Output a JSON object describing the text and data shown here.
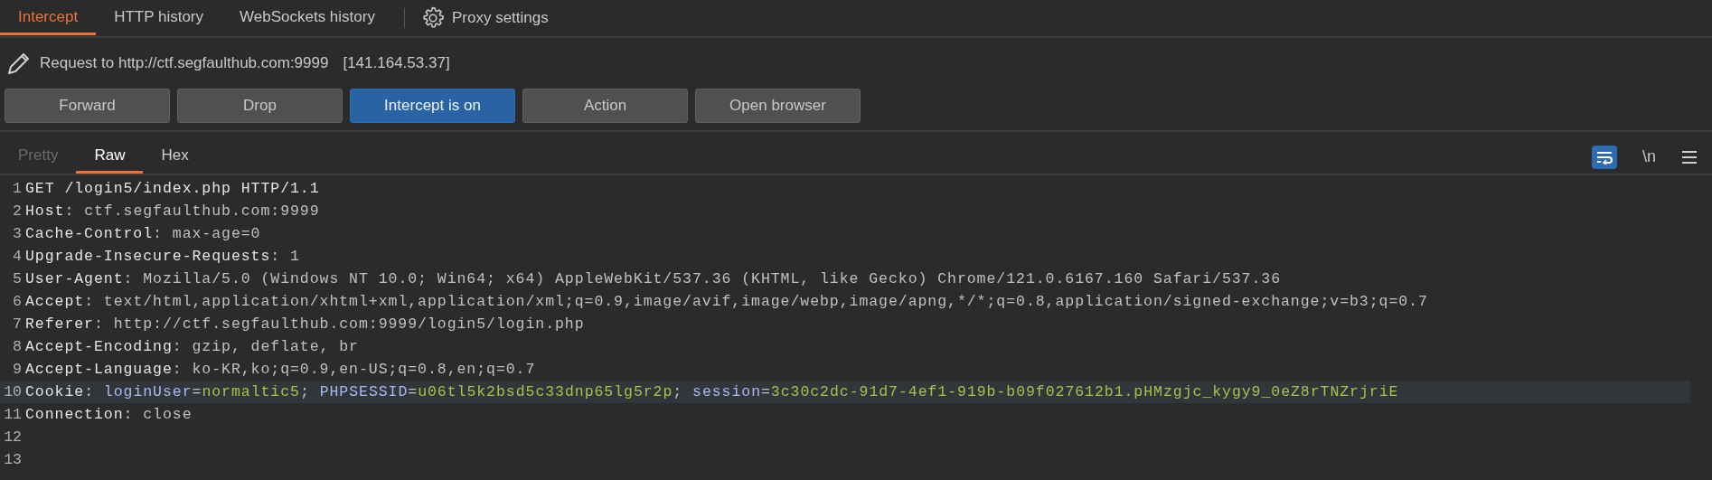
{
  "proxy_tabs": [
    {
      "label": "Intercept",
      "selected": true
    },
    {
      "label": "HTTP history",
      "selected": false
    },
    {
      "label": "WebSockets history",
      "selected": false
    }
  ],
  "settings_button": {
    "label": "Proxy settings"
  },
  "request": {
    "target": "Request to http://ctf.segfaulthub.com:9999",
    "ip": "[141.164.53.37]"
  },
  "buttons": [
    {
      "label": "Forward",
      "pressed": false
    },
    {
      "label": "Drop",
      "pressed": false
    },
    {
      "label": "Intercept is on",
      "pressed": true
    },
    {
      "label": "Action",
      "pressed": false
    },
    {
      "label": "Open browser",
      "pressed": false
    }
  ],
  "editor_tabs": [
    {
      "label": "Pretty",
      "selected": false,
      "disabled": true
    },
    {
      "label": "Raw",
      "selected": true,
      "disabled": false
    },
    {
      "label": "Hex",
      "selected": false,
      "disabled": false
    }
  ],
  "editor_tools": {
    "wrap_on": true,
    "newline_label": "\\n"
  },
  "lines": [
    {
      "number": "1",
      "highlighted": false,
      "tokens": [
        {
          "kind": "plain",
          "text": "GET /login5/index.php HTTP/1.1"
        }
      ]
    },
    {
      "number": "2",
      "highlighted": false,
      "tokens": [
        {
          "kind": "name",
          "text": "Host"
        },
        {
          "kind": "value",
          "text": ": ctf.segfaulthub.com:9999"
        }
      ]
    },
    {
      "number": "3",
      "highlighted": false,
      "tokens": [
        {
          "kind": "name",
          "text": "Cache-Control"
        },
        {
          "kind": "value",
          "text": ": max-age=0"
        }
      ]
    },
    {
      "number": "4",
      "highlighted": false,
      "tokens": [
        {
          "kind": "name",
          "text": "Upgrade-Insecure-Requests"
        },
        {
          "kind": "value",
          "text": ": 1"
        }
      ]
    },
    {
      "number": "5",
      "highlighted": false,
      "tokens": [
        {
          "kind": "name",
          "text": "User-Agent"
        },
        {
          "kind": "value",
          "text": ": Mozilla/5.0 (Windows NT 10.0; Win64; x64) AppleWebKit/537.36 (KHTML, like Gecko) Chrome/121.0.6167.160 Safari/537.36"
        }
      ]
    },
    {
      "number": "6",
      "highlighted": false,
      "tokens": [
        {
          "kind": "name",
          "text": "Accept"
        },
        {
          "kind": "value",
          "text": ": text/html,application/xhtml+xml,application/xml;q=0.9,image/avif,image/webp,image/apng,*/*;q=0.8,application/signed-exchange;v=b3;q=0.7"
        }
      ]
    },
    {
      "number": "7",
      "highlighted": false,
      "tokens": [
        {
          "kind": "name",
          "text": "Referer"
        },
        {
          "kind": "value",
          "text": ": http://ctf.segfaulthub.com:9999/login5/login.php"
        }
      ]
    },
    {
      "number": "8",
      "highlighted": false,
      "tokens": [
        {
          "kind": "name",
          "text": "Accept-Encoding"
        },
        {
          "kind": "value",
          "text": ": gzip, deflate, br"
        }
      ]
    },
    {
      "number": "9",
      "highlighted": false,
      "tokens": [
        {
          "kind": "name",
          "text": "Accept-Language"
        },
        {
          "kind": "value",
          "text": ": ko-KR,ko;q=0.9,en-US;q=0.8,en;q=0.7"
        }
      ]
    },
    {
      "number": "10",
      "highlighted": true,
      "tokens": [
        {
          "kind": "name",
          "text": "Cookie"
        },
        {
          "kind": "value",
          "text": ": "
        },
        {
          "kind": "cookie_key",
          "text": "loginUser"
        },
        {
          "kind": "value",
          "text": "="
        },
        {
          "kind": "cookie_value",
          "text": "normaltic5"
        },
        {
          "kind": "value",
          "text": "; "
        },
        {
          "kind": "cookie_key",
          "text": "PHPSESSID"
        },
        {
          "kind": "value",
          "text": "="
        },
        {
          "kind": "cookie_value",
          "text": "u06tl5k2bsd5c33dnp65lg5r2p"
        },
        {
          "kind": "value",
          "text": "; "
        },
        {
          "kind": "cookie_key",
          "text": "session"
        },
        {
          "kind": "value",
          "text": "="
        },
        {
          "kind": "cookie_value",
          "text": "3c30c2dc-91d7-4ef1-919b-b09f027612b1.pHMzgjc_kygy9_0eZ8rTNZrjriE"
        }
      ]
    },
    {
      "number": "11",
      "highlighted": false,
      "tokens": [
        {
          "kind": "name",
          "text": "Connection"
        },
        {
          "kind": "value",
          "text": ": close"
        }
      ]
    },
    {
      "number": "12",
      "highlighted": false
    },
    {
      "number": "13",
      "highlighted": false
    }
  ]
}
